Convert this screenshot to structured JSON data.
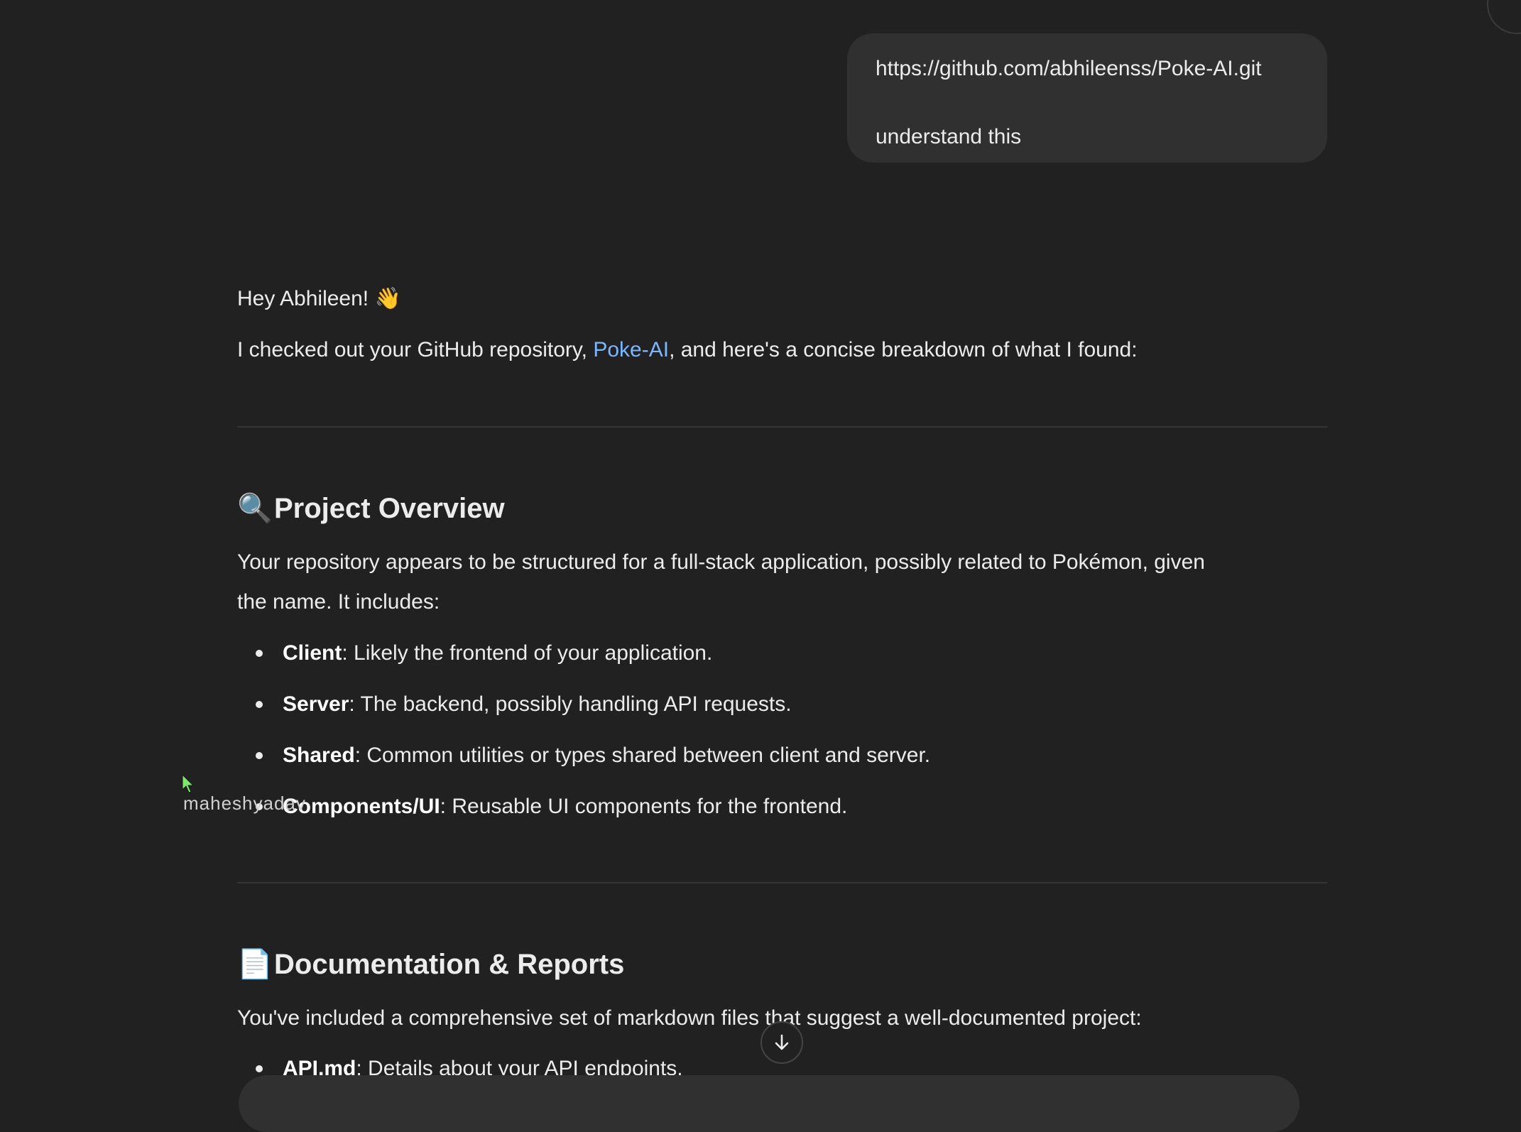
{
  "user_message": {
    "lines": [
      "https://github.com/abhileenss/Poke-AI.git",
      "understand this"
    ]
  },
  "reply": {
    "greeting": "Hey Abhileen! 👋",
    "intro_before": "I checked out your GitHub repository, ",
    "intro_link": "Poke-AI",
    "intro_after": ", and here's a concise breakdown of what I found:",
    "section1": {
      "emoji": "🔍",
      "title": "Project Overview",
      "para_line1": "Your repository appears to be structured for a full-stack application, possibly related to Pokémon, given",
      "para_line2": "the name. It includes:",
      "items": [
        {
          "term": "Client",
          "desc": ": Likely the frontend of your application."
        },
        {
          "term": "Server",
          "desc": ": The backend, possibly handling API requests."
        },
        {
          "term": "Shared",
          "desc": ": Common utilities or types shared between client and server."
        },
        {
          "term": "Components/UI",
          "desc": ": Reusable UI components for the frontend."
        }
      ]
    },
    "section2": {
      "emoji": "📄",
      "title": "Documentation & Reports",
      "para": "You've included a comprehensive set of markdown files that suggest a well-documented project:",
      "items": [
        {
          "term": "API.md",
          "desc": ": Details about your API endpoints."
        }
      ]
    }
  },
  "cursor_label": "maheshyadav",
  "icons": {
    "scroll_down": "arrow-down-icon",
    "cursor": "pointer-cursor-icon"
  },
  "colors": {
    "background": "#212121",
    "bubble": "#303030",
    "link": "#7ab7ff",
    "cursor": "#7ee86a"
  }
}
